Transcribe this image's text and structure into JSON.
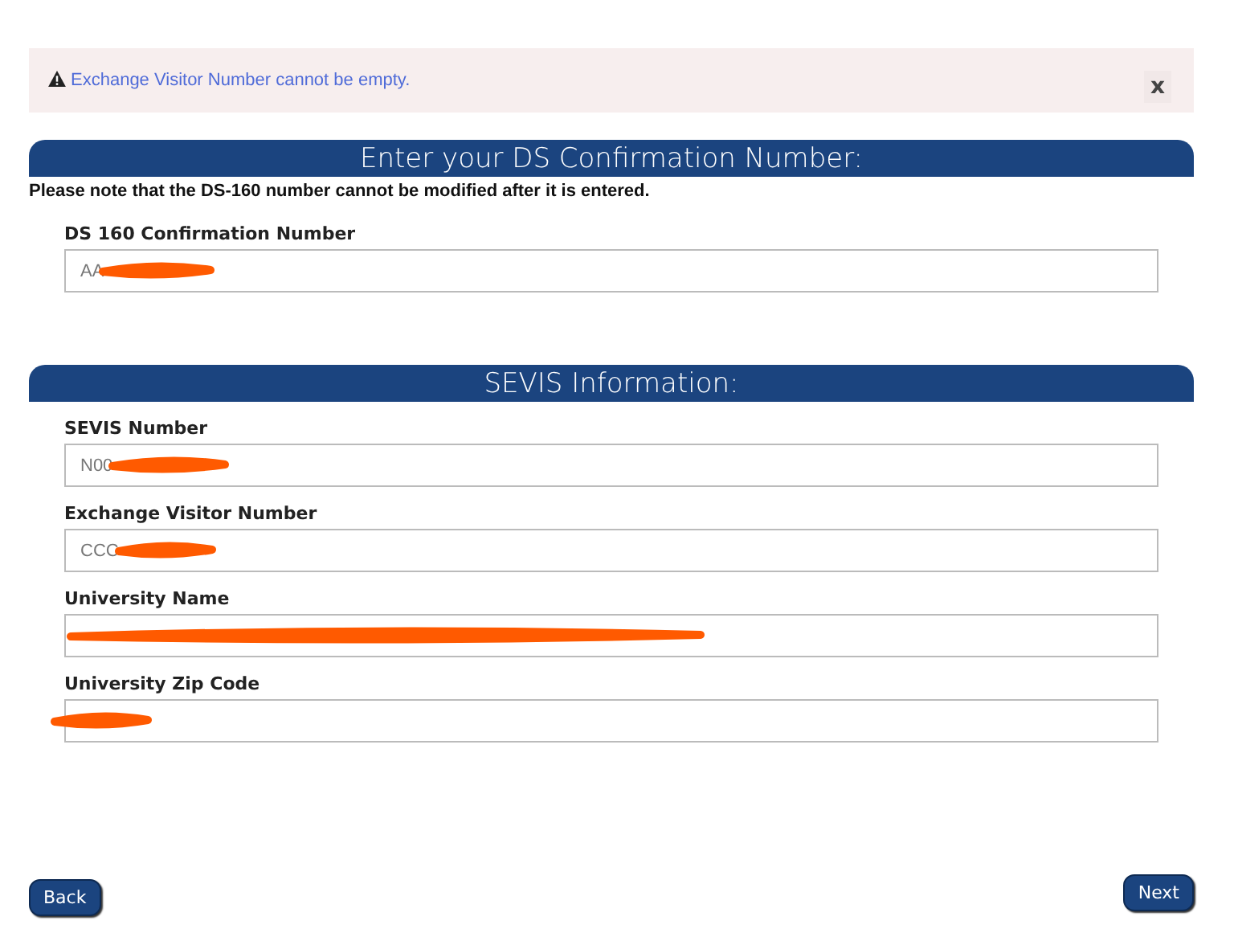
{
  "alert": {
    "message": "Exchange Visitor Number cannot be empty.",
    "close": "x"
  },
  "sections": [
    {
      "title": "Enter your DS Confirmation Number:",
      "note": "Please note that the DS-160 number cannot be modified after it is entered.",
      "fields": [
        {
          "label": "DS 160 Confirmation Number",
          "value": "AA",
          "redacted": true
        }
      ]
    },
    {
      "title": "SEVIS Information:",
      "fields": [
        {
          "label": "SEVIS Number",
          "value": "N00",
          "redacted": true
        },
        {
          "label": "Exchange Visitor Number",
          "value": "CCC",
          "redacted": true
        },
        {
          "label": "University Name",
          "redacted": true
        },
        {
          "label": "University Zip Code",
          "redacted": true
        }
      ]
    }
  ],
  "buttons": {
    "back": "Back",
    "next": "Next"
  }
}
